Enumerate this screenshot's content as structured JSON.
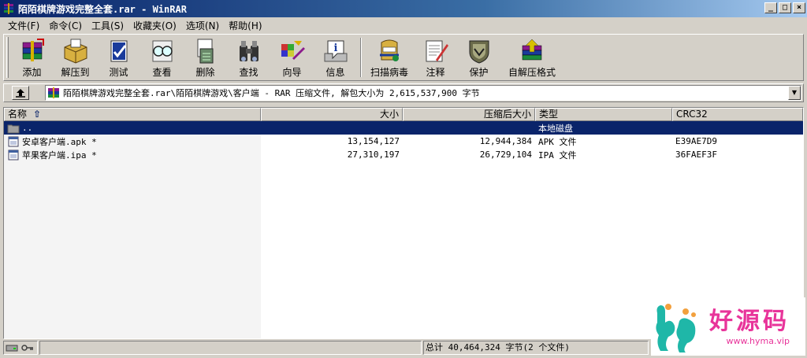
{
  "window": {
    "title": "陌陌棋牌游戏完整全套.rar - WinRAR",
    "minimize": "_",
    "maximize": "□",
    "close": "×"
  },
  "menu": [
    {
      "label": "文件(F)"
    },
    {
      "label": "命令(C)"
    },
    {
      "label": "工具(S)"
    },
    {
      "label": "收藏夹(O)"
    },
    {
      "label": "选项(N)"
    },
    {
      "label": "帮助(H)"
    }
  ],
  "toolbar": {
    "add": "添加",
    "extract_to": "解压到",
    "test": "测试",
    "view": "查看",
    "delete": "删除",
    "find": "查找",
    "wizard": "向导",
    "info": "信息",
    "virus_scan": "扫描病毒",
    "comment": "注释",
    "protect": "保护",
    "sfx": "自解压格式"
  },
  "address": {
    "path": "陌陌棋牌游戏完整全套.rar\\陌陌棋牌游戏\\客户端 - RAR 压缩文件, 解包大小为 2,615,537,900 字节"
  },
  "columns": {
    "name": "名称",
    "size": "大小",
    "packed": "压缩后大小",
    "type": "类型",
    "crc": "CRC32"
  },
  "files": [
    {
      "name": "..",
      "size": "",
      "packed": "",
      "type": "本地磁盘",
      "crc": "",
      "icon": "folder-icon",
      "selected": true
    },
    {
      "name": "安卓客户端.apk *",
      "size": "13,154,127",
      "packed": "12,944,384",
      "type": "APK 文件",
      "crc": "E39AE7D9",
      "icon": "file-icon",
      "selected": false
    },
    {
      "name": "苹果客户端.ipa *",
      "size": "27,310,197",
      "packed": "26,729,104",
      "type": "IPA 文件",
      "crc": "36FAEF3F",
      "icon": "file-icon",
      "selected": false
    }
  ],
  "status": {
    "total": "总计 40,464,324 字节(2 个文件)"
  },
  "watermark": {
    "title": "好源码",
    "url": "www.hyma.vip"
  }
}
